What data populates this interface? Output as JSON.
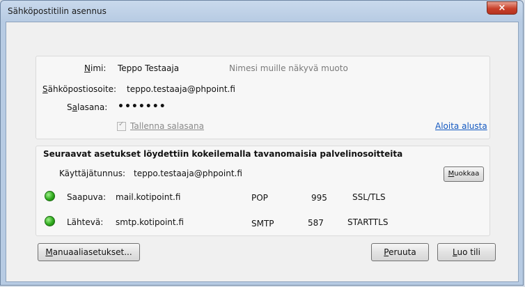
{
  "window": {
    "title": "Sähköpostitilin asennus",
    "close_label": "×"
  },
  "account": {
    "name_label": "Nimi:",
    "name_value": "Teppo Testaaja",
    "name_hint": "Nimesi muille näkyvä muoto",
    "email_label": "Sähköpostiosoite:",
    "email_value": "teppo.testaaja@phpoint.fi",
    "password_label": "Salasana:",
    "password_value": "•••••••",
    "remember_label": "Tallenna salasana",
    "remember_checked": true,
    "restart_link": "Aloita alusta"
  },
  "detected": {
    "heading": "Seuraavat asetukset löydettiin kokeilemalla tavanomaisia palvelinosoitteita",
    "username_label": "Käyttäjätunnus:",
    "username_value": "teppo.testaaja@phpoint.fi",
    "edit_button": "Muokkaa",
    "servers": [
      {
        "label": "Saapuva:",
        "host": "mail.kotipoint.fi",
        "protocol": "POP",
        "port": "995",
        "security": "SSL/TLS",
        "status_color": "#2faa1d"
      },
      {
        "label": "Lähtevä:",
        "host": "smtp.kotipoint.fi",
        "protocol": "SMTP",
        "port": "587",
        "security": "STARTTLS",
        "status_color": "#2faa1d"
      }
    ]
  },
  "footer": {
    "manual_button": "Manuaaliasetukset...",
    "cancel_button": "Peruuta",
    "create_button": "Luo tili"
  }
}
